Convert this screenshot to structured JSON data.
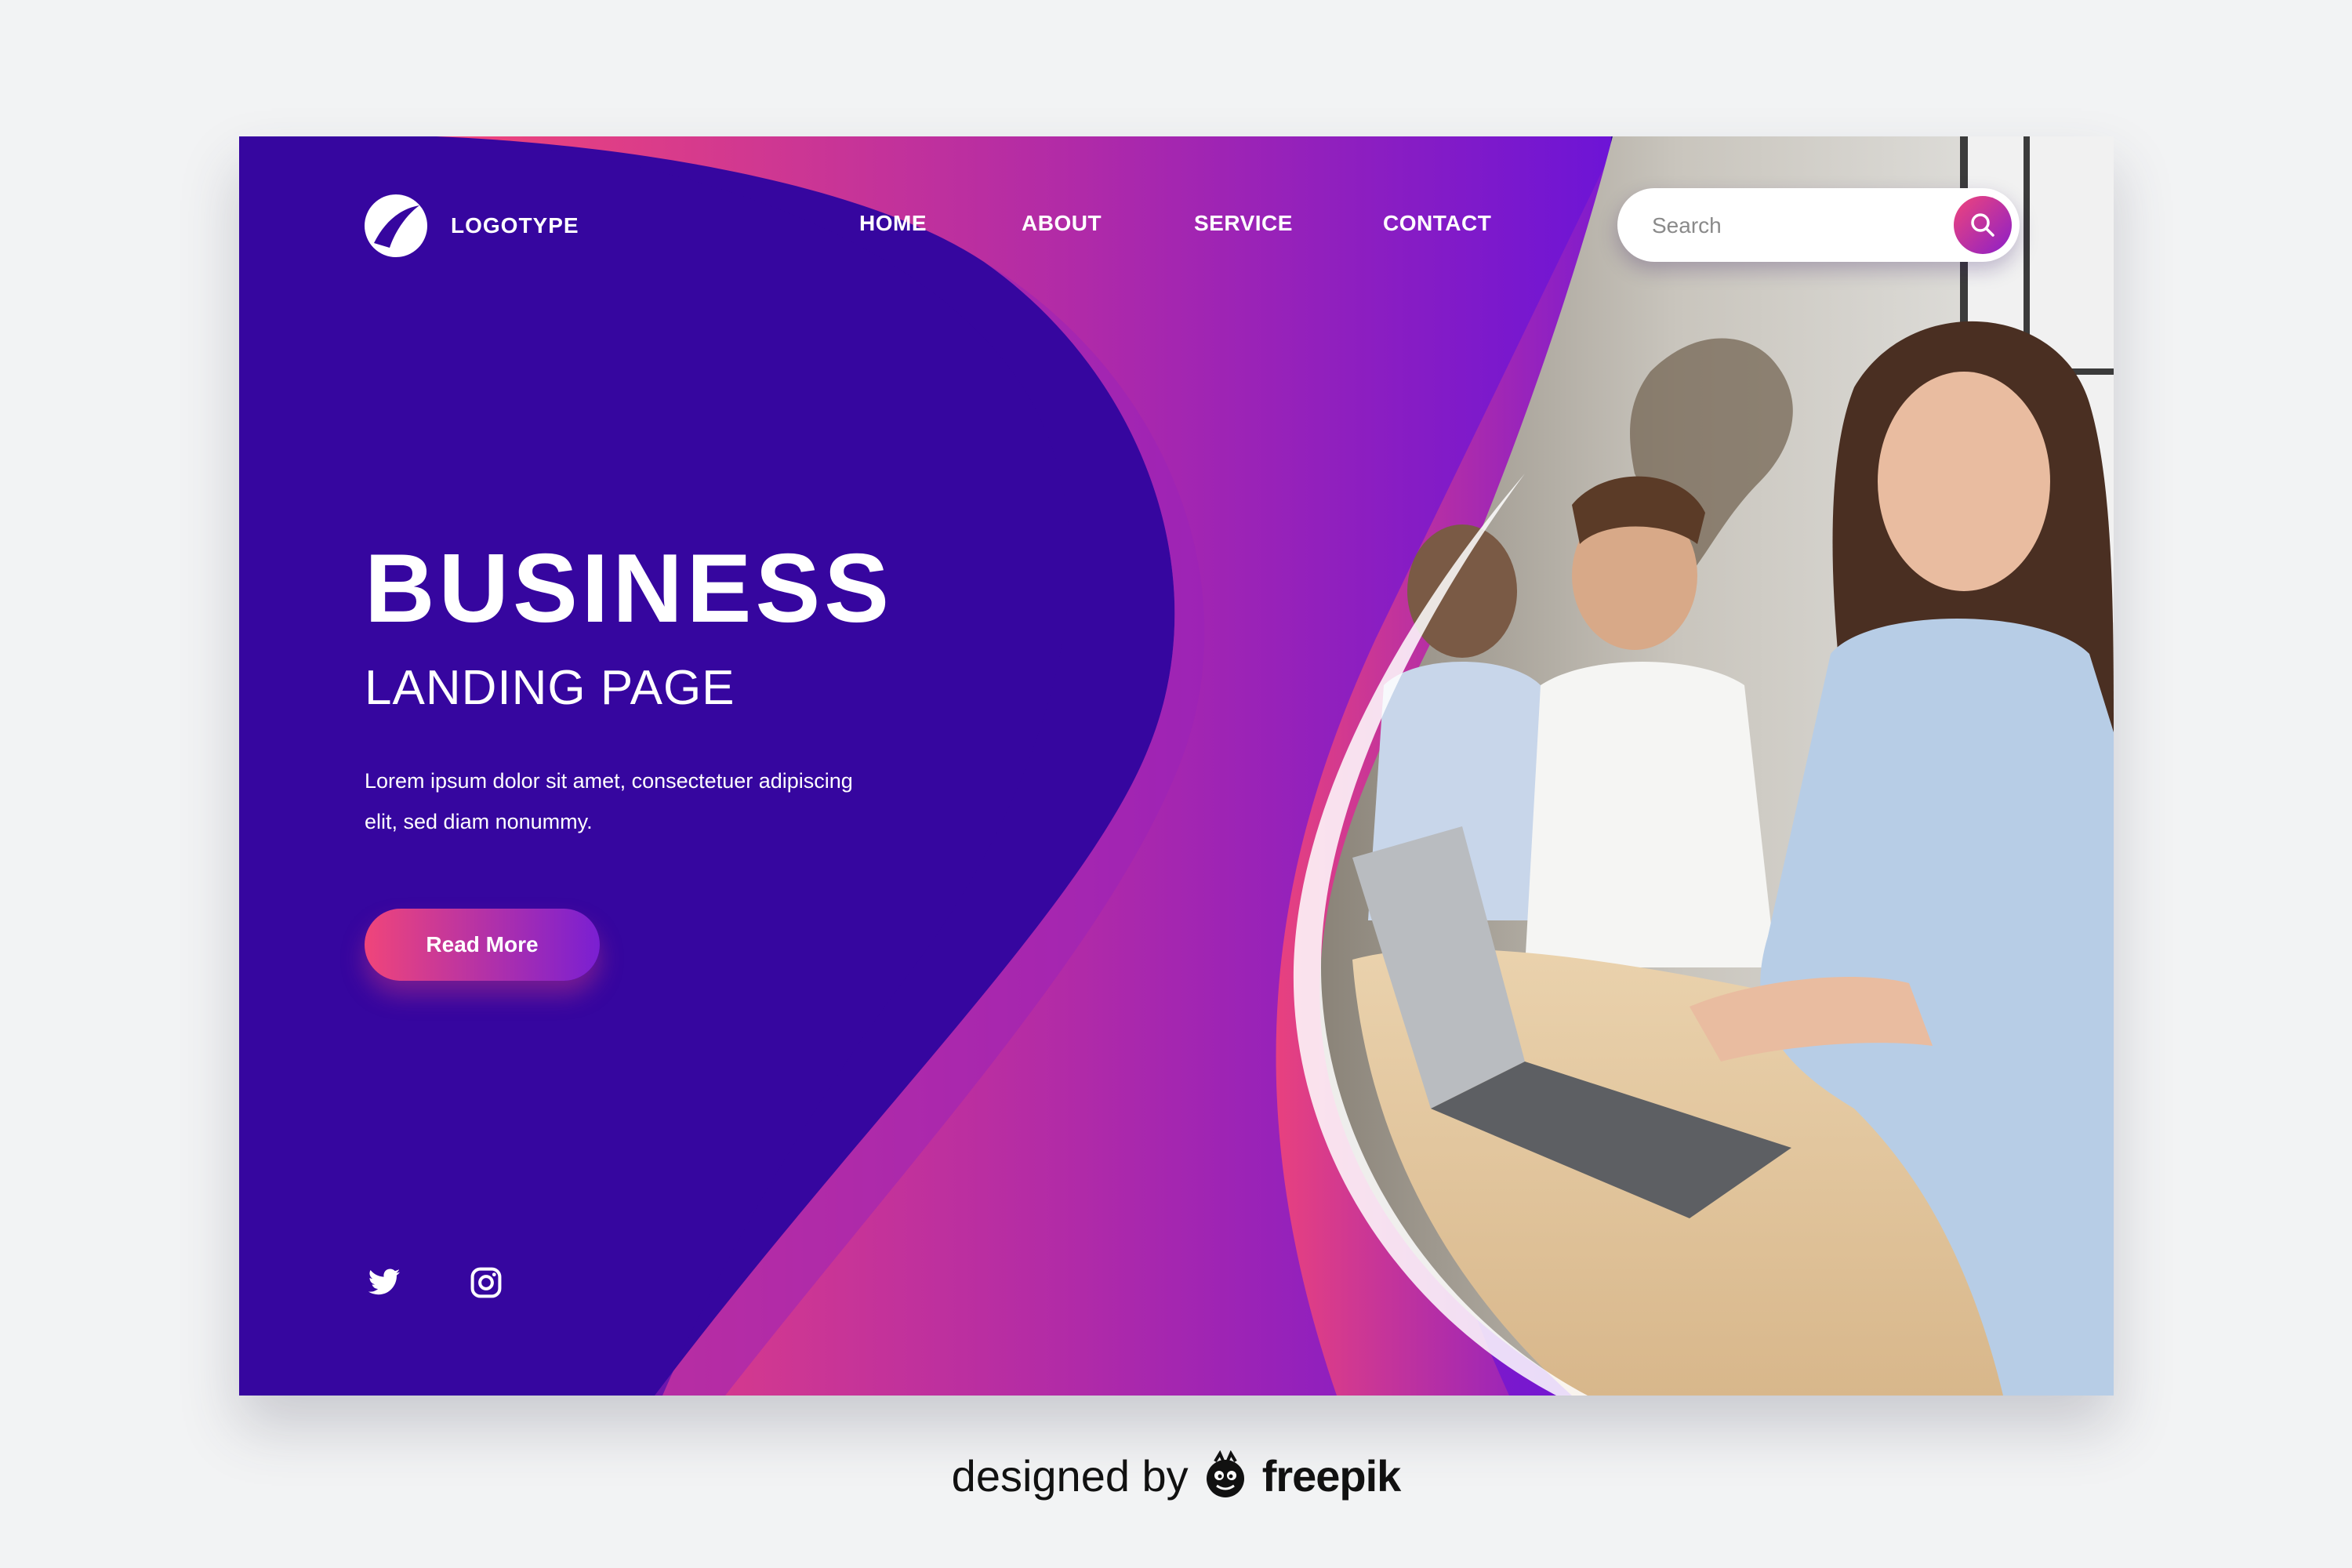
{
  "brand": {
    "logo_text": "LOGOTYPE",
    "logo_icon": "logo-mark-icon"
  },
  "nav": {
    "items": [
      "HOME",
      "ABOUT",
      "SERVICE",
      "CONTACT"
    ]
  },
  "search": {
    "placeholder": "Search",
    "icon": "search-icon"
  },
  "hero": {
    "title": "BUSINESS",
    "subtitle": "LANDING PAGE",
    "description": "Lorem ipsum dolor sit amet, consectetuer adipiscing elit, sed diam nonummy.",
    "cta_label": "Read More"
  },
  "social": {
    "icons": [
      "twitter-icon",
      "instagram-icon"
    ]
  },
  "credit": {
    "prefix": "designed by",
    "brand": "freepik",
    "icon": "freepik-mascot-icon"
  },
  "colors": {
    "deep_purple": "#36069f",
    "pink": "#f0457a",
    "violet": "#8b1fc9",
    "page_background": "#f2f3f4"
  }
}
